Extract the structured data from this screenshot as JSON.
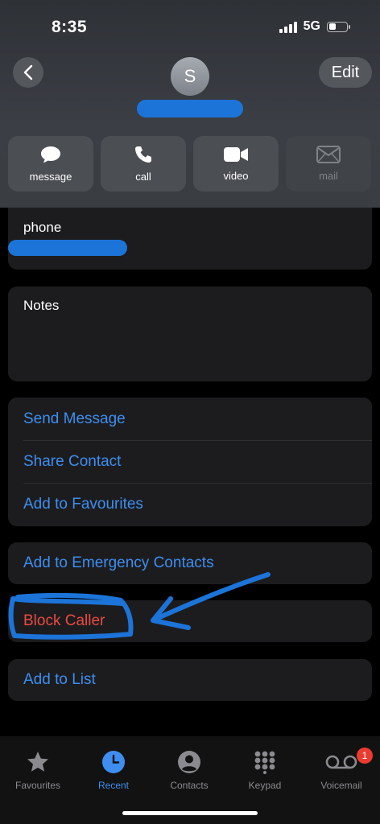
{
  "status": {
    "time": "8:35",
    "network": "5G",
    "signal_bars": 4,
    "battery_level": 0.4
  },
  "header": {
    "avatar_initial": "S",
    "edit_label": "Edit"
  },
  "actions": [
    {
      "label": "message",
      "icon": "message-bubble-icon",
      "enabled": true
    },
    {
      "label": "call",
      "icon": "phone-icon",
      "enabled": true
    },
    {
      "label": "video",
      "icon": "video-camera-icon",
      "enabled": true
    },
    {
      "label": "mail",
      "icon": "envelope-icon",
      "enabled": false
    }
  ],
  "phone_card": {
    "label": "phone"
  },
  "notes_card": {
    "label": "Notes"
  },
  "options_group": [
    "Send Message",
    "Share Contact",
    "Add to Favourites"
  ],
  "emergency": "Add to Emergency Contacts",
  "block": "Block Caller",
  "add_list": "Add to List",
  "tabbar": {
    "tabs": [
      {
        "label": "Favourites",
        "icon": "star-icon",
        "active": false
      },
      {
        "label": "Recent",
        "icon": "clock-icon",
        "active": true
      },
      {
        "label": "Contacts",
        "icon": "person-circle-icon",
        "active": false
      },
      {
        "label": "Keypad",
        "icon": "keypad-icon",
        "active": false
      },
      {
        "label": "Voicemail",
        "icon": "voicemail-icon",
        "active": false
      }
    ],
    "voicemail_badge": "1"
  },
  "colors": {
    "accent": "#3d8ef0",
    "destructive": "#eb4a42",
    "annotation": "#1c74d9"
  }
}
